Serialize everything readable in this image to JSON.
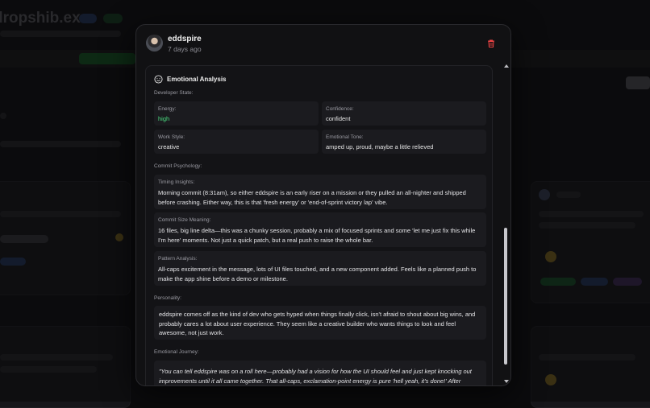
{
  "background": {
    "app_title": "dropshib.ex"
  },
  "modal": {
    "user": {
      "name": "eddspire",
      "time": "7 days ago"
    },
    "section": {
      "title": "Emotional Analysis",
      "developer_state_label": "Developer State:",
      "energy": {
        "label": "Energy:",
        "value": "high"
      },
      "confidence": {
        "label": "Confidence:",
        "value": "confident"
      },
      "work_style": {
        "label": "Work Style:",
        "value": "creative"
      },
      "emotional_tone": {
        "label": "Emotional Tone:",
        "value": "amped up, proud, maybe a little relieved"
      },
      "commit_psychology_label": "Commit Psychology:",
      "timing": {
        "label": "Timing Insights:",
        "text": "Morning commit (8:31am), so either eddspire is an early riser on a mission or they pulled an all-nighter and shipped before crashing. Either way, this is that 'fresh energy' or 'end-of-sprint victory lap' vibe."
      },
      "size": {
        "label": "Commit Size Meaning:",
        "text": "16 files, big line delta—this was a chunky session, probably a mix of focused sprints and some 'let me just fix this while I'm here' moments. Not just a quick patch, but a real push to raise the whole bar."
      },
      "pattern": {
        "label": "Pattern Analysis:",
        "text": "All-caps excitement in the message, lots of UI files touched, and a new component added. Feels like a planned push to make the app shine before a demo or milestone."
      },
      "personality_label": "Personality:",
      "personality_text": "eddspire comes off as the kind of dev who gets hyped when things finally click, isn't afraid to shout about big wins, and probably cares a lot about user experience. They seem like a creative builder who wants things to look and feel awesome, not just work.",
      "journey_label": "Emotional Journey:",
      "journey_text": "\"You can tell eddspire was on a roll here—probably had a vision for how the UI should feel and just kept knocking out improvements until it all came together. That all-caps, exclamation-point energy is pure 'hell yeah, it's done!' After crossing the finish line there's a real sense of relief and pride.\""
    }
  },
  "colors": {
    "accent_green": "#4ade80",
    "delete_red": "#ef4444"
  },
  "icons": {
    "delete": "trash-icon",
    "analysis": "smile-icon"
  }
}
